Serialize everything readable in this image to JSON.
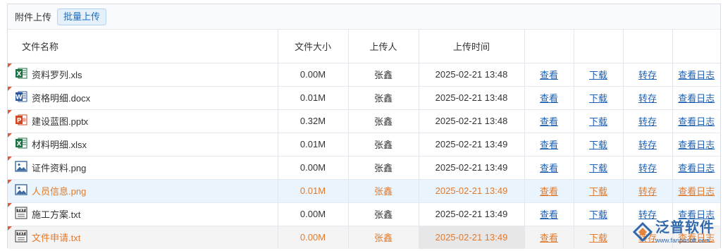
{
  "toolbar": {
    "label": "附件上传",
    "batch_button": "批量上传"
  },
  "columns": {
    "name": "文件名称",
    "size": "文件大小",
    "uploader": "上传人",
    "time": "上传时间"
  },
  "actions": {
    "view": "查看",
    "download": "下载",
    "transfer": "转存",
    "log": "查看日志"
  },
  "rows": [
    {
      "icon": "excel-icon",
      "name": "资料罗列.xls",
      "size": "0.00M",
      "uploader": "张鑫",
      "time": "2025-02-21 13:48"
    },
    {
      "icon": "word-icon",
      "name": "资格明细.docx",
      "size": "0.01M",
      "uploader": "张鑫",
      "time": "2025-02-21 13:48"
    },
    {
      "icon": "powerpoint-icon",
      "name": "建设蓝图.pptx",
      "size": "0.32M",
      "uploader": "张鑫",
      "time": "2025-02-21 13:48"
    },
    {
      "icon": "excel-icon",
      "name": "材料明细.xlsx",
      "size": "0.01M",
      "uploader": "张鑫",
      "time": "2025-02-21 13:49"
    },
    {
      "icon": "image-icon",
      "name": "证件资料.png",
      "size": "0.00M",
      "uploader": "张鑫",
      "time": "2025-02-21 13:49"
    },
    {
      "icon": "image-icon",
      "name": "人员信息.png",
      "size": "0.01M",
      "uploader": "张鑫",
      "time": "2025-02-21 13:49"
    },
    {
      "icon": "txt-icon",
      "name": "施工方案.txt",
      "size": "0.00M",
      "uploader": "张鑫",
      "time": "2025-02-21 13:49"
    },
    {
      "icon": "txt-icon",
      "name": "文件申请.txt",
      "size": "0.00M",
      "uploader": "张鑫",
      "time": "2025-02-21 13:49"
    }
  ],
  "watermark": {
    "title": "泛普软件",
    "url": "www.fanpusoft.com"
  },
  "colors": {
    "link": "#1a5fb4",
    "highlight_text": "#e07a2e",
    "selected_row": "#eaf4fc",
    "hover_row": "#f4f4f4"
  }
}
